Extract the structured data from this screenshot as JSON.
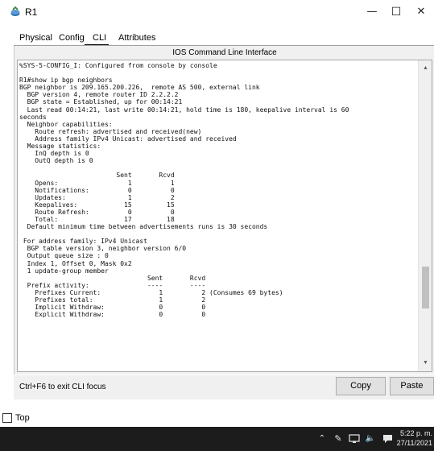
{
  "window": {
    "title": "R1",
    "icon": "router-icon"
  },
  "tabs": [
    {
      "label": "Physical",
      "active": false
    },
    {
      "label": "Config",
      "active": false
    },
    {
      "label": "CLI",
      "active": true
    },
    {
      "label": "Attributes",
      "active": false
    }
  ],
  "panel": {
    "title": "IOS Command Line Interface"
  },
  "terminal": {
    "lines": [
      "%SYS-5-CONFIG_I: Configured from console by console",
      "",
      "R1#show ip bgp neighbors",
      "BGP neighbor is 209.165.200.226,  remote AS 500, external link",
      "  BGP version 4, remote router ID 2.2.2.2",
      "  BGP state = Established, up for 00:14:21",
      "  Last read 00:14:21, last write 00:14:21, hold time is 180, keepalive interval is 60",
      "seconds",
      "  Neighbor capabilities:",
      "    Route refresh: advertised and received(new)",
      "    Address family IPv4 Unicast: advertised and received",
      "  Message statistics:",
      "    InQ depth is 0",
      "    OutQ depth is 0",
      "",
      "                         Sent       Rcvd",
      "    Opens:                  1          1",
      "    Notifications:          0          0",
      "    Updates:                1          2",
      "    Keepalives:            15         15",
      "    Route Refresh:          0          0",
      "    Total:                 17         18",
      "  Default minimum time between advertisements runs is 30 seconds",
      "",
      " For address family: IPv4 Unicast",
      "  BGP table version 3, neighbor version 6/0",
      "  Output queue size : 0",
      "  Index 1, Offset 0, Mask 0x2",
      "  1 update-group member",
      "                                 Sent       Rcvd",
      "  Prefix activity:               ----       ----",
      "    Prefixes Current:               1          2 (Consumes 69 bytes)",
      "    Prefixes total:                 1          2",
      "    Implicit Withdraw:              0          0",
      "    Explicit Withdraw:              0          0"
    ],
    "scroll_thumb_position": 0.8
  },
  "footer": {
    "hint": "Ctrl+F6 to exit CLI focus",
    "copy_label": "Copy",
    "paste_label": "Paste"
  },
  "top_checkbox": {
    "label": "Top",
    "checked": false
  },
  "taskbar": {
    "time": "5:22 p. m.",
    "date": "27/11/2021",
    "tray_icons": [
      "chevron-up-icon",
      "pen-icon",
      "network-icon",
      "volume-icon",
      "notification-icon"
    ]
  },
  "colors": {
    "taskbar_bg": "#1c1c1c",
    "panel_bg": "#f0f0f0",
    "terminal_bg": "#ffffff"
  }
}
